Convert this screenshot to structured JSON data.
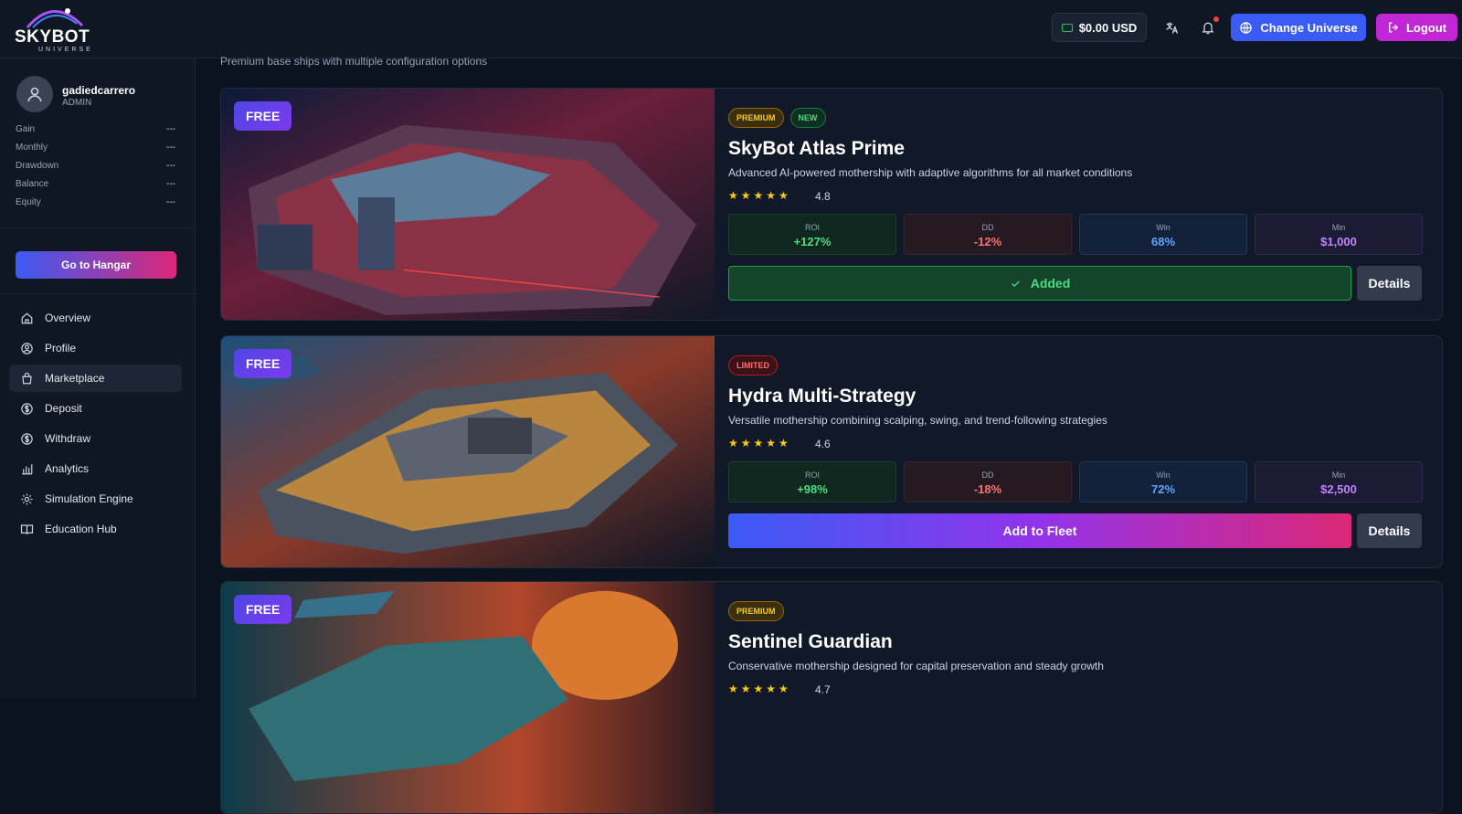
{
  "brand": {
    "name": "SKYBOT",
    "sub": "UNIVERSE"
  },
  "topbar": {
    "balance": "$0.00 USD",
    "change_universe": "Change Universe",
    "logout": "Logout"
  },
  "user": {
    "name": "gadiedcarrero",
    "role": "ADMIN",
    "stats": [
      {
        "label": "Gain",
        "value": "---"
      },
      {
        "label": "Monthly",
        "value": "---"
      },
      {
        "label": "Drawdown",
        "value": "---"
      },
      {
        "label": "Balance",
        "value": "---"
      },
      {
        "label": "Equity",
        "value": "---"
      }
    ]
  },
  "sidebar": {
    "hangar_button": "Go to Hangar",
    "items": [
      {
        "label": "Overview",
        "icon": "home-icon"
      },
      {
        "label": "Profile",
        "icon": "user-circle-icon"
      },
      {
        "label": "Marketplace",
        "icon": "shopping-bag-icon",
        "active": true
      },
      {
        "label": "Deposit",
        "icon": "dollar-circle-icon"
      },
      {
        "label": "Withdraw",
        "icon": "dollar-circle-icon"
      },
      {
        "label": "Analytics",
        "icon": "bar-chart-icon"
      },
      {
        "label": "Simulation Engine",
        "icon": "gear-icon"
      },
      {
        "label": "Education Hub",
        "icon": "book-icon"
      }
    ]
  },
  "main": {
    "subtitle": "Premium base ships with multiple configuration options",
    "cards": [
      {
        "badge": "FREE",
        "tags": [
          "PREMIUM",
          "NEW"
        ],
        "title": "SkyBot Atlas Prime",
        "description": "Advanced AI-powered mothership with adaptive algorithms for all market conditions",
        "stars": "★★★★★",
        "rating": "4.8",
        "metrics": {
          "roi_label": "ROI",
          "roi": "+127%",
          "dd_label": "DD",
          "dd": "-12%",
          "win_label": "Win",
          "win": "68%",
          "min_label": "Min",
          "min": "$1,000"
        },
        "action": "Added",
        "details": "Details"
      },
      {
        "badge": "FREE",
        "tags": [
          "LIMITED"
        ],
        "title": "Hydra Multi-Strategy",
        "description": "Versatile mothership combining scalping, swing, and trend-following strategies",
        "stars": "★★★★★",
        "rating": "4.6",
        "metrics": {
          "roi_label": "ROI",
          "roi": "+98%",
          "dd_label": "DD",
          "dd": "-18%",
          "win_label": "Win",
          "win": "72%",
          "min_label": "Min",
          "min": "$2,500"
        },
        "action": "Add to Fleet",
        "details": "Details"
      },
      {
        "badge": "FREE",
        "tags": [
          "PREMIUM"
        ],
        "title": "Sentinel Guardian",
        "description": "Conservative mothership designed for capital preservation and steady growth",
        "stars": "★★★★★",
        "rating": "4.7"
      }
    ]
  }
}
